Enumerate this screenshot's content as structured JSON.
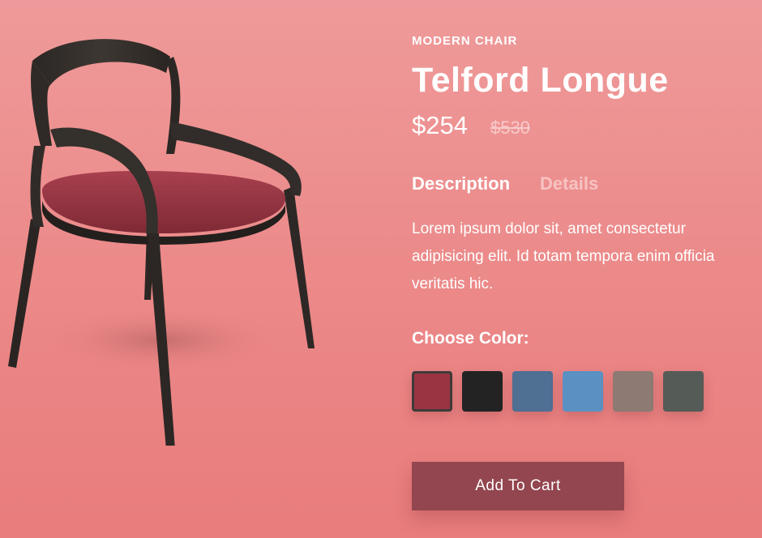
{
  "product": {
    "category": "MODERN CHAIR",
    "title": "Telford Longue",
    "price_current": "$254",
    "price_old": "$530",
    "image_icon": "chair-image"
  },
  "tabs": [
    {
      "label": "Description",
      "active": true
    },
    {
      "label": "Details",
      "active": false
    }
  ],
  "description": "Lorem ipsum dolor sit, amet consectetur adipisicing elit. Id totam tempora enim officia veritatis hic.",
  "colors": {
    "label": "Choose Color:",
    "swatches": [
      {
        "name": "crimson-fabric",
        "hex": "#9b3442",
        "selected": true
      },
      {
        "name": "black-fabric",
        "hex": "#232323",
        "selected": false
      },
      {
        "name": "denim-blue-fabric",
        "hex": "#4f6f93",
        "selected": false
      },
      {
        "name": "light-blue-fabric",
        "hex": "#5b90c2",
        "selected": false
      },
      {
        "name": "taupe-fabric",
        "hex": "#8c7a73",
        "selected": false
      },
      {
        "name": "grey-green-fabric",
        "hex": "#555b57",
        "selected": false
      }
    ]
  },
  "cart": {
    "button_label": "Add To Cart",
    "button_color": "#93464f"
  },
  "theme": {
    "background": "#ec8b8b",
    "text": "#ffffff"
  }
}
